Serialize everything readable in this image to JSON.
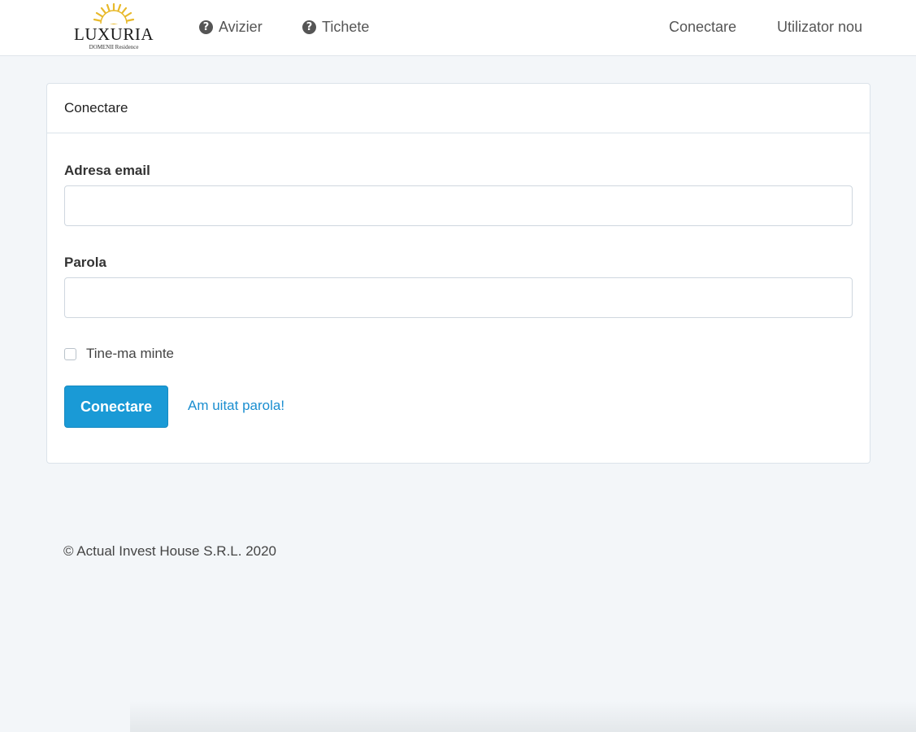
{
  "brand": {
    "name": "LUXURIA",
    "subtitle": "DOMENII Residence",
    "colors": {
      "sun": "#e8b92a"
    }
  },
  "nav": {
    "left": [
      {
        "label": "Avizier",
        "icon": "question-circle-icon"
      },
      {
        "label": "Tichete",
        "icon": "question-circle-icon"
      }
    ],
    "right": [
      {
        "label": "Conectare"
      },
      {
        "label": "Utilizator nou"
      }
    ]
  },
  "login_card": {
    "title": "Conectare",
    "email_label": "Adresa email",
    "email_value": "",
    "password_label": "Parola",
    "password_value": "",
    "remember_label": "Tine-ma minte",
    "remember_checked": false,
    "submit_label": "Conectare",
    "forgot_label": "Am uitat parola!"
  },
  "footer": {
    "copyright": "© Actual Invest House S.R.L. 2020"
  },
  "colors": {
    "primary": "#1a9ad6",
    "link": "#1a8ed0",
    "page_bg": "#f3f6f9"
  }
}
